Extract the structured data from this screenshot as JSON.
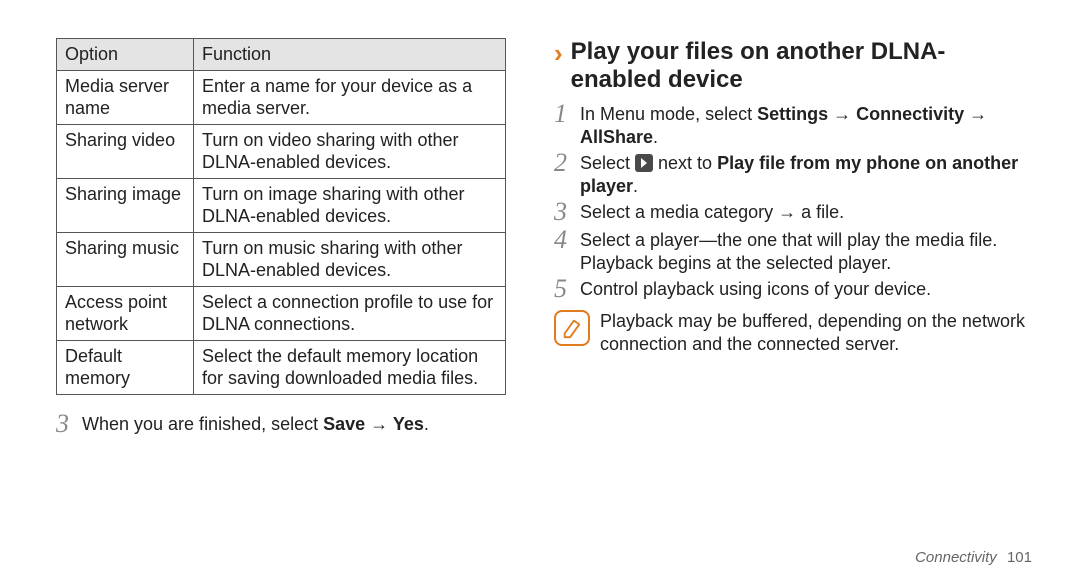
{
  "table": {
    "header_option": "Option",
    "header_function": "Function",
    "rows": [
      {
        "option": "Media server name",
        "function": "Enter a name for your device as a media server."
      },
      {
        "option": "Sharing video",
        "function": "Turn on video sharing with other DLNA-enabled devices."
      },
      {
        "option": "Sharing image",
        "function": "Turn on image sharing with other DLNA-enabled devices."
      },
      {
        "option": "Sharing music",
        "function": "Turn on music sharing with other DLNA-enabled devices."
      },
      {
        "option": "Access point network",
        "function": "Select a connection profile to use for DLNA connections."
      },
      {
        "option": "Default memory",
        "function": "Select the default memory location for saving downloaded media files."
      }
    ]
  },
  "left_step3": {
    "num": "3",
    "pre": "When you are finished, select ",
    "bold": "Save → Yes",
    "post": "."
  },
  "heading": "Play your files on another DLNA-enabled device",
  "r_steps": {
    "s1": {
      "num": "1",
      "pre": "In Menu mode, select ",
      "bold": "Settings → Connectivity → AllShare",
      "post": "."
    },
    "s2": {
      "num": "2",
      "pre": "Select ",
      "mid": " next to ",
      "bold": "Play file from my phone on another player",
      "post": "."
    },
    "s3": {
      "num": "3",
      "text": "Select a media category → a file."
    },
    "s4": {
      "num": "4",
      "text": "Select a player—the one that will play the media file. Playback begins at the selected player."
    },
    "s5": {
      "num": "5",
      "text": "Control playback using icons of your device."
    }
  },
  "note": "Playback may be buffered, depending on the network connection and the connected server.",
  "footer": {
    "section": "Connectivity",
    "page": "101"
  }
}
